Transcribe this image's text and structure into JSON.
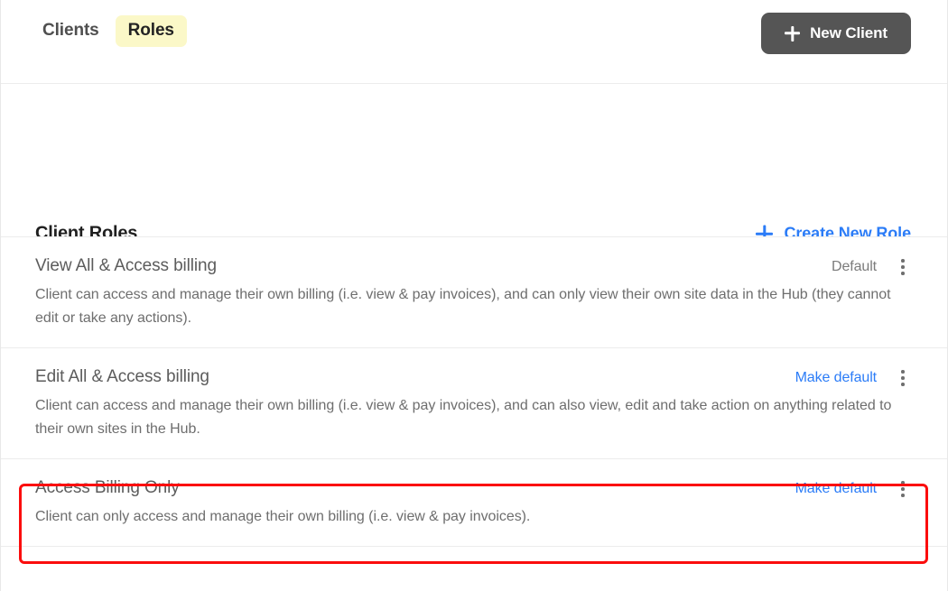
{
  "header": {
    "tabs": [
      {
        "label": "Clients",
        "active": false
      },
      {
        "label": "Roles",
        "active": true
      }
    ],
    "new_client_button": "New Client"
  },
  "section": {
    "title": "Client Roles",
    "create_role_link": "Create New Role"
  },
  "roles": [
    {
      "name": "View All & Access billing",
      "status": "Default",
      "status_is_link": false,
      "description": "Client can access and manage their own billing (i.e. view & pay invoices), and can only view their own site data in the Hub (they cannot edit or take any actions)."
    },
    {
      "name": "Edit All & Access billing",
      "status": "Make default",
      "status_is_link": true,
      "description": "Client can access and manage their own billing (i.e. view & pay invoices), and can also view, edit and take action on anything related to their own sites in the Hub."
    },
    {
      "name": "Access Billing Only",
      "status": "Make default",
      "status_is_link": true,
      "description": "Client can only access and manage their own billing (i.e. view & pay invoices)."
    }
  ],
  "annotation": {
    "highlight_color": "#fb0d0d",
    "target_role": "Access Billing Only"
  },
  "colors": {
    "accent_blue": "#2b7cf7",
    "tab_highlight": "#fbf8c8",
    "button_dark": "#555555",
    "text_primary": "#1f1f1f",
    "text_secondary": "#6e6e6e",
    "divider": "#ececec"
  },
  "icons": {
    "plus": "plus-icon",
    "kebab": "kebab-menu-icon"
  }
}
